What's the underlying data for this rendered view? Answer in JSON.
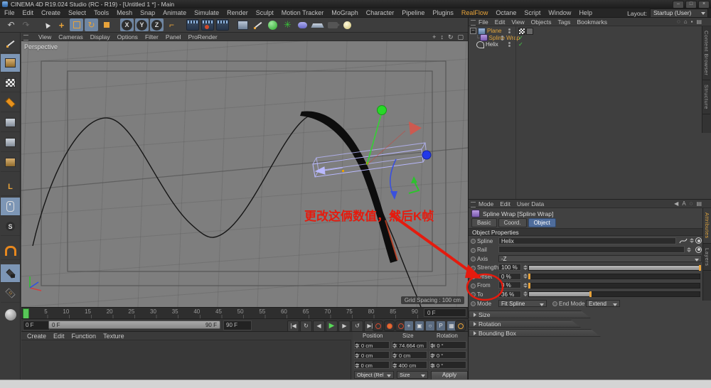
{
  "window": {
    "title": "CINEMA 4D R19.024 Studio (RC - R19) - [Untitled 1 *] - Main",
    "min": "–",
    "max": "□",
    "close": "×"
  },
  "menu_bar": {
    "items": [
      "File",
      "Edit",
      "Create",
      "Select",
      "Tools",
      "Mesh",
      "Snap",
      "Animate",
      "Simulate",
      "Render",
      "Sculpt",
      "Motion Tracker",
      "MoGraph",
      "Character",
      "Pipeline",
      "Plugins",
      "RealFlow",
      "Octane",
      "Script",
      "Window",
      "Help"
    ],
    "layout_label": "Layout:",
    "layout_value": "Startup (User)"
  },
  "toolbar": {
    "axis_locks": [
      "X",
      "Y",
      "Z"
    ]
  },
  "viewport": {
    "menu": [
      "View",
      "Cameras",
      "Display",
      "Options",
      "Filter",
      "Panel",
      "ProRender"
    ],
    "nav_icons": [
      "+",
      "↕",
      "↻",
      "▢"
    ],
    "camera_label": "Perspective",
    "grid_spacing": "Grid Spacing : 100 cm",
    "annotation": "更改这俩数值，然后K帧"
  },
  "object_manager": {
    "menu": [
      "File",
      "Edit",
      "View",
      "Objects",
      "Tags",
      "Bookmarks"
    ],
    "header_icons": [
      "◌",
      "⌂",
      "▪",
      "▤"
    ],
    "objects": [
      {
        "name": "Plane"
      },
      {
        "name": "Spline Wrap"
      },
      {
        "name": "Helix"
      }
    ],
    "check_glyph": "✓",
    "expander": "–",
    "side_tabs": [
      "Content Browser",
      "Structure"
    ]
  },
  "attribute_manager": {
    "menu": [
      "Mode",
      "Edit",
      "User Data"
    ],
    "header_icons": [
      "◀",
      "A",
      "◌",
      "▤"
    ],
    "title": "Spline Wrap [Spline Wrap]",
    "tabs": [
      "Basic",
      "Coord.",
      "Object"
    ],
    "section": "Object Properties",
    "fields": {
      "spline": {
        "label": "Spline",
        "value": "Helix"
      },
      "rail": {
        "label": "Rail",
        "value": ""
      },
      "axis": {
        "label": "Axis",
        "value": "-Z"
      },
      "strength": {
        "label": "Strength",
        "value": "100 %",
        "pct": 100
      },
      "offset": {
        "label": "Offset",
        "value": "0 %",
        "pct": 0
      },
      "from": {
        "label": "From",
        "value": "0 %",
        "pct": 0
      },
      "to": {
        "label": "To",
        "value": "36 %",
        "pct": 36
      },
      "mode": {
        "label": "Mode",
        "value": "Fit Spline"
      },
      "end_mode": {
        "label": "End Mode",
        "value": "Extend"
      }
    },
    "collapsed_sections": [
      "Size",
      "Rotation",
      "Bounding Box"
    ],
    "side_tabs": [
      "Attributes",
      "Layers"
    ]
  },
  "timeline": {
    "ticks": [
      "0",
      "5",
      "10",
      "15",
      "20",
      "25",
      "30",
      "35",
      "40",
      "45",
      "50",
      "55",
      "60",
      "65",
      "70",
      "75",
      "80",
      "85",
      "90"
    ],
    "current_frame": "0 F"
  },
  "transport": {
    "start_frame": "0 F",
    "range_start": "0 F",
    "range_end": "90 F",
    "end_frame": "90 F",
    "buttons": [
      {
        "g": "|◀"
      },
      {
        "g": "↻"
      },
      {
        "g": "◀"
      },
      {
        "g": "▶",
        "class": "play"
      },
      {
        "g": "▶"
      },
      {
        "g": "↺"
      },
      {
        "g": "▶|"
      }
    ],
    "toggles": [
      {
        "g": "+"
      },
      {
        "g": "▣"
      },
      {
        "g": "○"
      },
      {
        "g": "P"
      },
      {
        "g": "▦"
      }
    ]
  },
  "bottom_panel": {
    "menu": [
      "Create",
      "Edit",
      "Function",
      "Texture"
    ],
    "coordinates": {
      "headers": [
        "Position",
        "Size",
        "Rotation"
      ],
      "cells": [
        {
          "l": "X",
          "v": "0 cm"
        },
        {
          "l": "X",
          "v": "74.664 cm"
        },
        {
          "l": "H",
          "v": "0 °"
        },
        {
          "l": "Y",
          "v": "0 cm"
        },
        {
          "l": "Y",
          "v": "0 cm"
        },
        {
          "l": "P",
          "v": "0 °"
        },
        {
          "l": "Z",
          "v": "0 cm"
        },
        {
          "l": "Z",
          "v": "400 cm"
        },
        {
          "l": "B",
          "v": "0 °"
        }
      ],
      "mode_dropdown": "Object (Rel",
      "size_dropdown": "Size",
      "apply_button": "Apply"
    }
  },
  "colors": {
    "accent_orange": "#E8A33A",
    "annotation_red": "#E51B0E",
    "play_green": "#58C858",
    "active_tab_blue": "#4F6D9C",
    "viewport_gray": "#7E7E7E"
  }
}
